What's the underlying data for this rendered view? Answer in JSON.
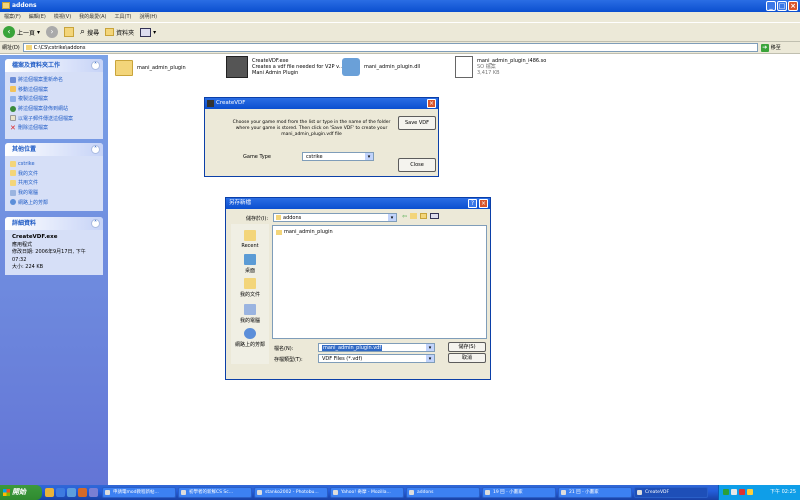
{
  "window": {
    "title": "addons",
    "minimize_icon": "minimize-icon",
    "maximize_icon": "maximize-icon",
    "close_icon": "close-icon"
  },
  "menu": [
    "檔案(F)",
    "編輯(E)",
    "檢視(V)",
    "我的最愛(A)",
    "工具(T)",
    "說明(H)"
  ],
  "toolbar": {
    "back_label": "上一頁",
    "search_label": "搜尋",
    "folders_label": "資料夾"
  },
  "address": {
    "label": "網址(D)",
    "path": "C:\\CS\\cstrike\\addons",
    "go_label": "移至"
  },
  "file_tasks": {
    "title": "檔案及資料夾工作",
    "items": [
      "將這個檔案重新命名",
      "移動這個檔案",
      "複製這個檔案",
      "將這個檔案發佈到網站",
      "以電子郵件傳送這個檔案",
      "刪除這個檔案"
    ]
  },
  "other_places": {
    "title": "其他位置",
    "items": [
      "cstrike",
      "我的文件",
      "共用文件",
      "我的電腦",
      "網路上的芳鄰"
    ]
  },
  "details": {
    "title": "詳細資料",
    "name": "CreateVDF.exe",
    "type": "應用程式",
    "modified": "修改日期: 2006年9月17日, 下午 07:32",
    "size": "大小: 224 KB"
  },
  "files": {
    "folder": {
      "name": "mani_admin_plugin"
    },
    "exe": {
      "line1": "CreateVDF.exe",
      "line2": "Creates a vdf file needed for V2P v...",
      "line3": "Mani Admin Plugin"
    },
    "dll": {
      "name": "mani_admin_plugin.dll"
    },
    "so": {
      "line1": "mani_admin_plugin_i486.so",
      "line2": "SO 檔案",
      "line3": "3,417 KB"
    }
  },
  "createvdf": {
    "title": "CreateVDF",
    "message": "Choose your game mod from the list or type in the name of the folder where your game is stored. Then click on 'Save VDF' to create your mani_admin_plugin.vdf file",
    "save_button": "Save VDF",
    "game_type_label": "Game Type",
    "game_type_value": "cstrike",
    "close_button": "Close"
  },
  "saveas": {
    "title": "另存新檔",
    "save_in_label": "儲存於(I):",
    "save_in_value": "addons",
    "list_items": [
      "mani_admin_plugin"
    ],
    "places": [
      "Recent",
      "桌面",
      "我的文件",
      "我的電腦",
      "網路上的芳鄰"
    ],
    "filename_label": "檔名(N):",
    "filename_value": "mani_admin_plugin.vdf",
    "filetype_label": "存檔類型(T):",
    "filetype_value": "VDF Files (*.vdf)",
    "save_button": "儲存(S)",
    "cancel_button": "取消"
  },
  "taskbar": {
    "start_label": "開始",
    "tasks": [
      "申請電mod教程新帖...",
      "初學者的新鮮CS Sc...",
      "stanko2002 - Photobu...",
      "Yahoo! 奇摩 - Mozilla...",
      "addons",
      "19 回 - 小畫家",
      "21 回 - 小畫家",
      "CreateVDF"
    ],
    "time": "下午 02:25"
  }
}
